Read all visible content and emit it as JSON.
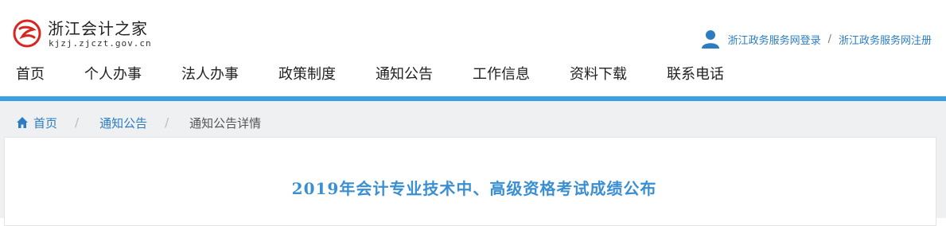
{
  "header": {
    "site_name": "浙江会计之家",
    "site_domain": "kjzj.zjczt.gov.cn",
    "login_link": "浙江政务服务网登录",
    "separator": "/",
    "register_link": "浙江政务服务网注册"
  },
  "nav": {
    "items": [
      {
        "label": "首页"
      },
      {
        "label": "个人办事"
      },
      {
        "label": "法人办事"
      },
      {
        "label": "政策制度"
      },
      {
        "label": "通知公告"
      },
      {
        "label": "工作信息"
      },
      {
        "label": "资料下载"
      },
      {
        "label": "联系电话"
      }
    ]
  },
  "breadcrumb": {
    "home": "首页",
    "sep": "/",
    "section": "通知公告",
    "current": "通知公告详情"
  },
  "article": {
    "title": "2019年会计专业技术中、高级资格考试成绩公布"
  },
  "colors": {
    "accent_blue": "#39a0e5",
    "link_blue": "#2b7cc1",
    "title_blue": "#3a8fd3",
    "logo_red": "#d9251d"
  },
  "icons": [
    "logo-icon",
    "user-icon",
    "home-icon"
  ]
}
